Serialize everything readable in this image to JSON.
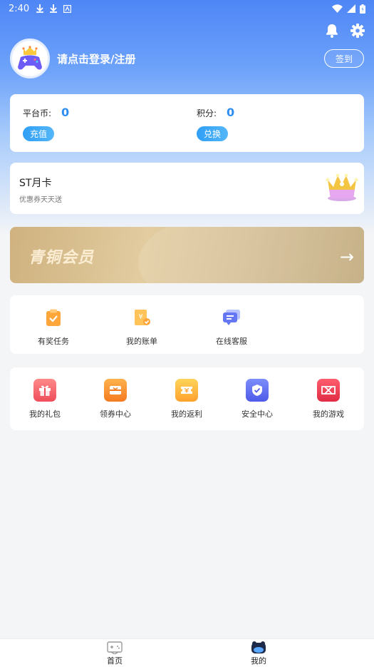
{
  "status_bar": {
    "time": "2:40"
  },
  "profile": {
    "login_text": "请点击登录/注册",
    "signin_label": "签到"
  },
  "wallet": {
    "platform_coin_label": "平台币:",
    "platform_coin_value": "0",
    "recharge_label": "充值",
    "points_label": "积分:",
    "points_value": "0",
    "exchange_label": "兑换"
  },
  "st_card": {
    "title": "ST月卡",
    "subtitle": "优惠券天天送"
  },
  "member_banner": {
    "title": "青铜会员",
    "arrow": "→"
  },
  "services": [
    {
      "label": "有奖任务",
      "icon": "task-icon"
    },
    {
      "label": "我的账单",
      "icon": "bill-icon"
    },
    {
      "label": "在线客服",
      "icon": "chat-icon"
    }
  ],
  "features": [
    {
      "label": "我的礼包",
      "icon": "gift-icon"
    },
    {
      "label": "领券中心",
      "icon": "coupon-center-icon"
    },
    {
      "label": "我的返利",
      "icon": "rebate-icon"
    },
    {
      "label": "安全中心",
      "icon": "shield-icon"
    },
    {
      "label": "我的游戏",
      "icon": "gamepad-icon"
    }
  ],
  "tabbar": [
    {
      "label": "首页",
      "icon": "home-gamepad-icon"
    },
    {
      "label": "我的",
      "icon": "profile-icon"
    }
  ],
  "colors": {
    "accent": "#2e8ef0",
    "hero_top": "#4e86f6",
    "bronze": "#d7c197"
  }
}
